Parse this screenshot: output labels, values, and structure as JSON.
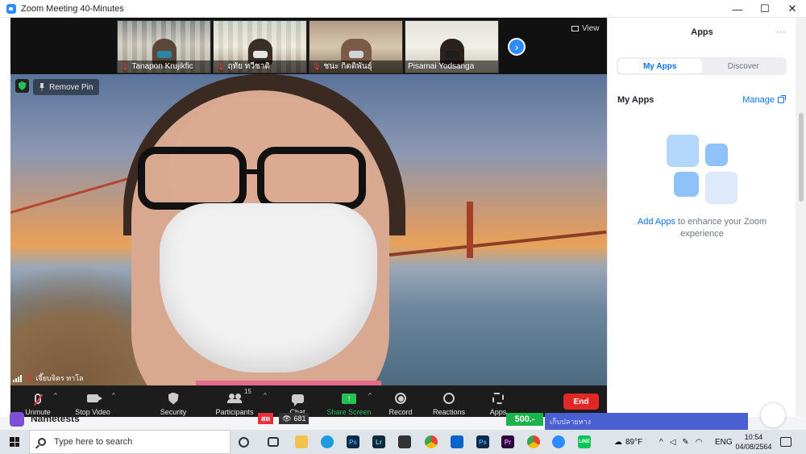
{
  "window": {
    "title": "Zoom Meeting 40-Minutes",
    "controls": {
      "minimize": "—",
      "maximize": "☐",
      "close": "✕"
    }
  },
  "participants_strip": {
    "thumbnails": [
      {
        "name": "Tanapon Krujikfic",
        "muted": true
      },
      {
        "name": "ฤทัย ทวีชาติ",
        "muted": true
      },
      {
        "name": "ชนะ กิตติพันธุ์",
        "muted": true
      },
      {
        "name": "Pisamai Yodsanga",
        "muted": false
      }
    ],
    "next_arrow": "›",
    "view_label": "View"
  },
  "main_video": {
    "remove_pin_label": "Remove Pin",
    "speaker_name": "เจี๊ยบจิตร ทาโล",
    "speaker_muted": true
  },
  "toolbar": {
    "unmute_label": "Unmute",
    "stop_video_label": "Stop Video",
    "security_label": "Security",
    "participants_label": "Participants",
    "participants_count": "15",
    "chat_label": "Chat",
    "share_screen_label": "Share Screen",
    "share_arrow": "↑",
    "record_label": "Record",
    "reactions_label": "Reactions",
    "apps_label": "Apps",
    "end_label": "End",
    "caret": "^"
  },
  "apps_panel": {
    "title": "Apps",
    "more": "···",
    "tabs": [
      {
        "label": "My Apps",
        "active": true
      },
      {
        "label": "Discover",
        "active": false
      }
    ],
    "section_heading": "My Apps",
    "manage_label": "Manage",
    "empty_link": "Add Apps",
    "empty_text_1": " to enhance your Zoom",
    "empty_text_2": "experience"
  },
  "background_page": {
    "app_name": "Nametests",
    "live_badge": "สด",
    "viewer_count": "681",
    "price_chip": "500.-",
    "banner_text": "เก็บปลายทาง"
  },
  "taskbar": {
    "search_placeholder": "Type here to search",
    "apps": [
      "task-view",
      "file-explorer",
      "edge",
      "photoshop",
      "lightroom",
      "store",
      "chrome",
      "mail",
      "photoshop-2",
      "premiere",
      "chrome-2",
      "zoom",
      "line"
    ],
    "weather": "89°F",
    "language": "ENG",
    "time": "10:54",
    "date": "04/08/2564"
  },
  "colors": {
    "zoom_blue": "#2d8cff",
    "link_blue": "#0e71eb",
    "end_red": "#e02828",
    "share_green": "#26c155",
    "toolbar_bg": "#1c1c1c"
  }
}
